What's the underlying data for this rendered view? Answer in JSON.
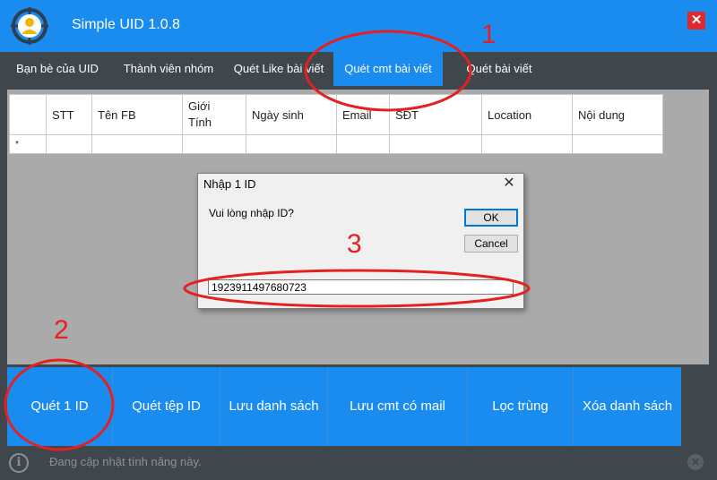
{
  "app": {
    "title": "Simple UID 1.0.8",
    "close_glyph": "✕",
    "accent": "#1a8cf0"
  },
  "tabs": [
    {
      "label": "Bạn bè của UID"
    },
    {
      "label": "Thành viên nhóm"
    },
    {
      "label": "Quét Like bài viết"
    },
    {
      "label": "Quét cmt bài viết",
      "active": true
    },
    {
      "label": "Quét bài viết"
    }
  ],
  "grid": {
    "columns": [
      "",
      "STT",
      "Tên FB",
      "Giới\nTính",
      "Ngày sinh",
      "Email",
      "SĐT",
      "Location",
      "Nội dung"
    ],
    "new_row_marker": "*"
  },
  "dialog": {
    "title": "Nhập 1 ID",
    "close_glyph": "✕",
    "prompt": "Vui lòng nhập ID?",
    "ok_label": "OK",
    "cancel_label": "Cancel",
    "input_value": "1923911497680723"
  },
  "buttons": [
    {
      "label": "Quét 1 ID"
    },
    {
      "label": "Quét tệp ID"
    },
    {
      "label": "Lưu danh sách"
    },
    {
      "label": "Lưu cmt có mail"
    },
    {
      "label": "Lọc trùng"
    },
    {
      "label": "Xóa danh sách"
    }
  ],
  "status": {
    "icon_glyph": "i",
    "text": "Đang cập nhật tính năng này.",
    "close_glyph": "✕"
  },
  "annotations": {
    "one": "1",
    "two": "2",
    "three": "3",
    "color": "#e52020"
  }
}
